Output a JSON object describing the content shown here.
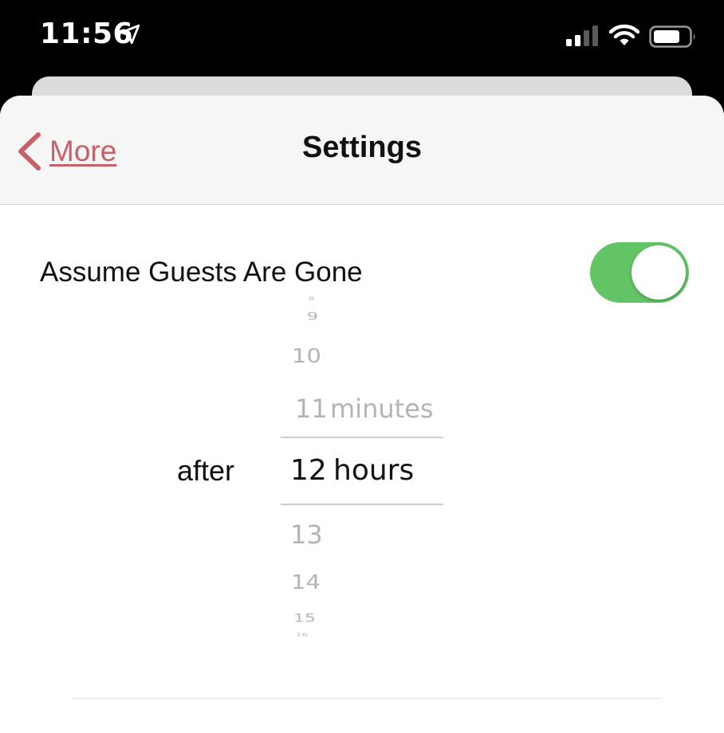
{
  "status_bar": {
    "time": "11:56",
    "icons": [
      "location-arrow-icon",
      "cellular-signal-icon",
      "wifi-icon",
      "battery-icon"
    ]
  },
  "nav": {
    "back_label": "More",
    "title": "Settings"
  },
  "setting": {
    "label": "Assume Guests Are Gone",
    "toggle_on": true
  },
  "picker": {
    "prefix": "after",
    "values": [
      "8",
      "9",
      "10",
      "11",
      "12",
      "13",
      "14",
      "15",
      "16"
    ],
    "selected_value": "12",
    "units": [
      "minutes",
      "hours"
    ],
    "selected_unit": "hours"
  },
  "colors": {
    "accent": "#c8606a",
    "toggle_green": "#63c466"
  }
}
